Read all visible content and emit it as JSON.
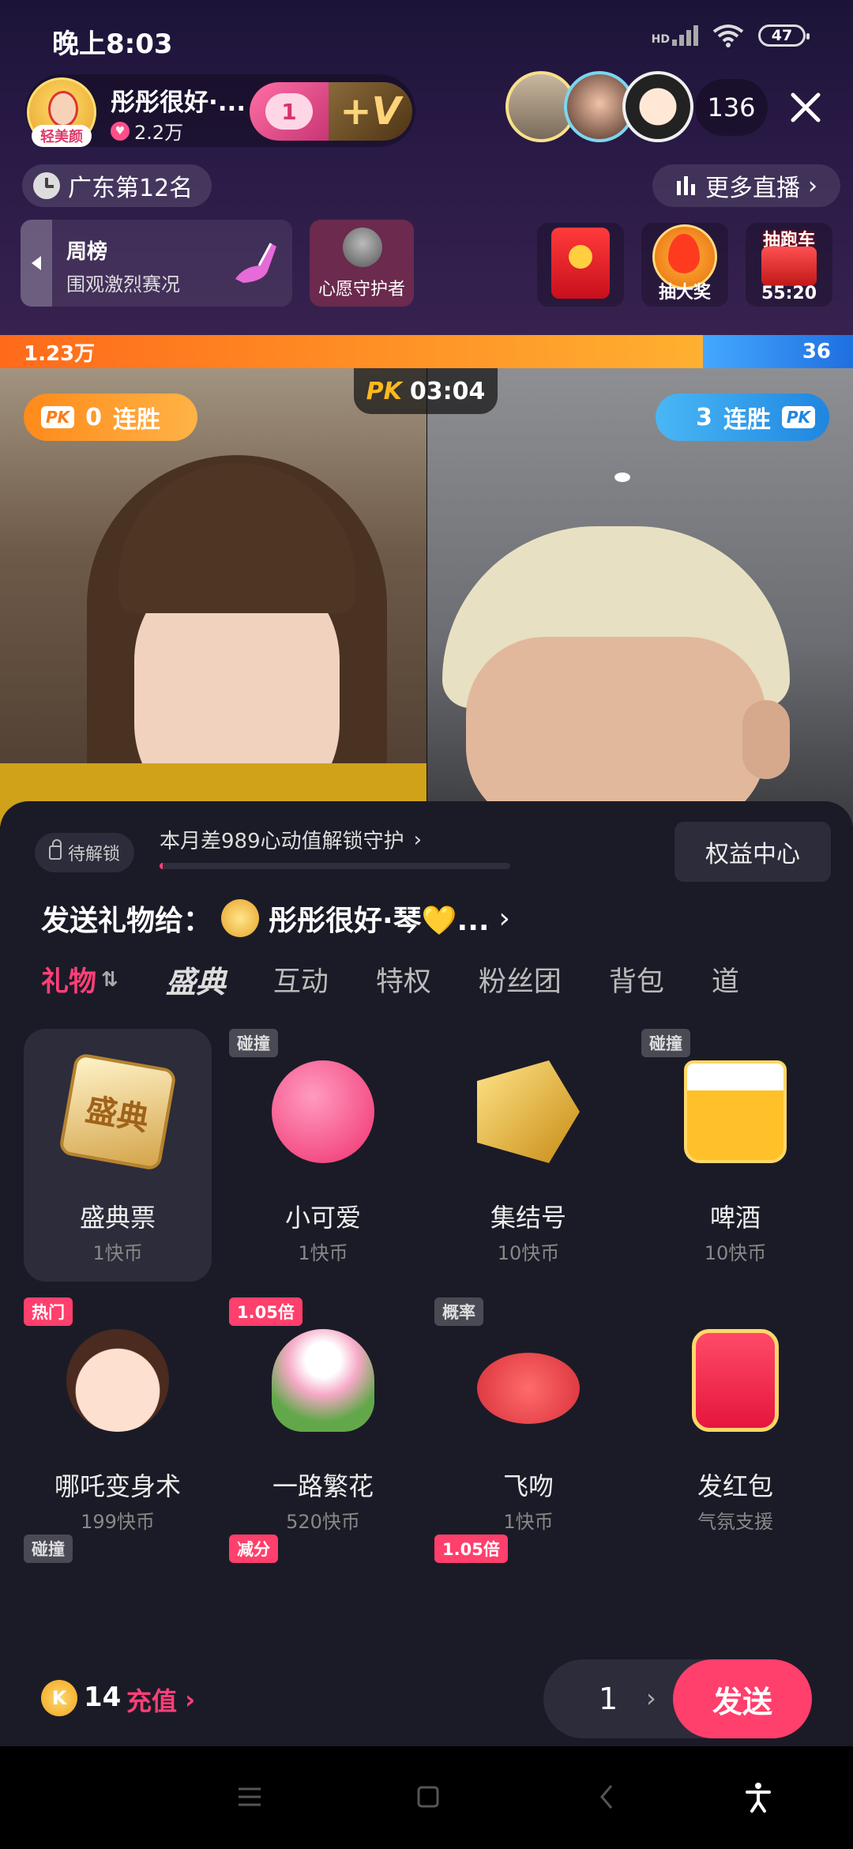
{
  "status_bar": {
    "time": "晚上8:03",
    "signal": "HD",
    "battery": "47"
  },
  "host": {
    "name": "彤彤很好·...",
    "likes": "2.2万",
    "avatar_tag": "轻美颜",
    "vip_level": "1",
    "vip_plus": "+V"
  },
  "viewers": {
    "count": "136"
  },
  "region": {
    "label": "广东第12名"
  },
  "more_live": {
    "label": "更多直播"
  },
  "weekly": {
    "title": "周榜",
    "subtitle": "围观激烈赛况"
  },
  "guardian": {
    "label": "心愿守护者"
  },
  "activities": {
    "lottery_label": "抽大奖",
    "car_title": "抽跑车",
    "car_timer": "55:20"
  },
  "pk": {
    "left_score": "1.23万",
    "right_score": "36",
    "logo": "PK",
    "timer": "03:04",
    "left_streak_num": "0",
    "right_streak_num": "3",
    "streak_label": "连胜"
  },
  "gift_panel": {
    "lock_label": "待解锁",
    "unlock_hint": "本月差989心动值解锁守护",
    "unlock_progress": 0.01,
    "benefits_label": "权益中心",
    "send_to_prefix": "发送礼物给：",
    "send_to_name": "彤彤很好·琴💛...",
    "tabs": [
      "礼物",
      "盛典",
      "互动",
      "特权",
      "粉丝团",
      "背包",
      "道"
    ],
    "gifts": [
      {
        "name": "盛典票",
        "price": "1快币",
        "badge": "",
        "art_text": "盛典"
      },
      {
        "name": "小可爱",
        "price": "1快币",
        "badge": "碰撞"
      },
      {
        "name": "集结号",
        "price": "10快币",
        "badge": ""
      },
      {
        "name": "啤酒",
        "price": "10快币",
        "badge": "碰撞"
      },
      {
        "name": "哪吒变身术",
        "price": "199快币",
        "badge": "热门"
      },
      {
        "name": "一路繁花",
        "price": "520快币",
        "badge": "1.05倍"
      },
      {
        "name": "飞吻",
        "price": "1快币",
        "badge": "概率"
      },
      {
        "name": "发红包",
        "price": "气氛支援",
        "badge": ""
      }
    ],
    "partial_badges": [
      "碰撞",
      "减分",
      "1.05倍"
    ],
    "balance": "14",
    "coin_symbol": "K",
    "recharge_label": "充值",
    "quantity": "1",
    "send_label": "发送"
  },
  "colors": {
    "accent": "#ff3f6c",
    "pk_left": "#ff8a1a",
    "pk_right": "#1f86e0"
  },
  "icons": [
    "close-icon",
    "clock-icon",
    "bars-icon",
    "lock-icon",
    "chevron-right-icon",
    "sort-icon",
    "menu-icon",
    "home-icon",
    "back-icon",
    "accessibility-icon"
  ]
}
